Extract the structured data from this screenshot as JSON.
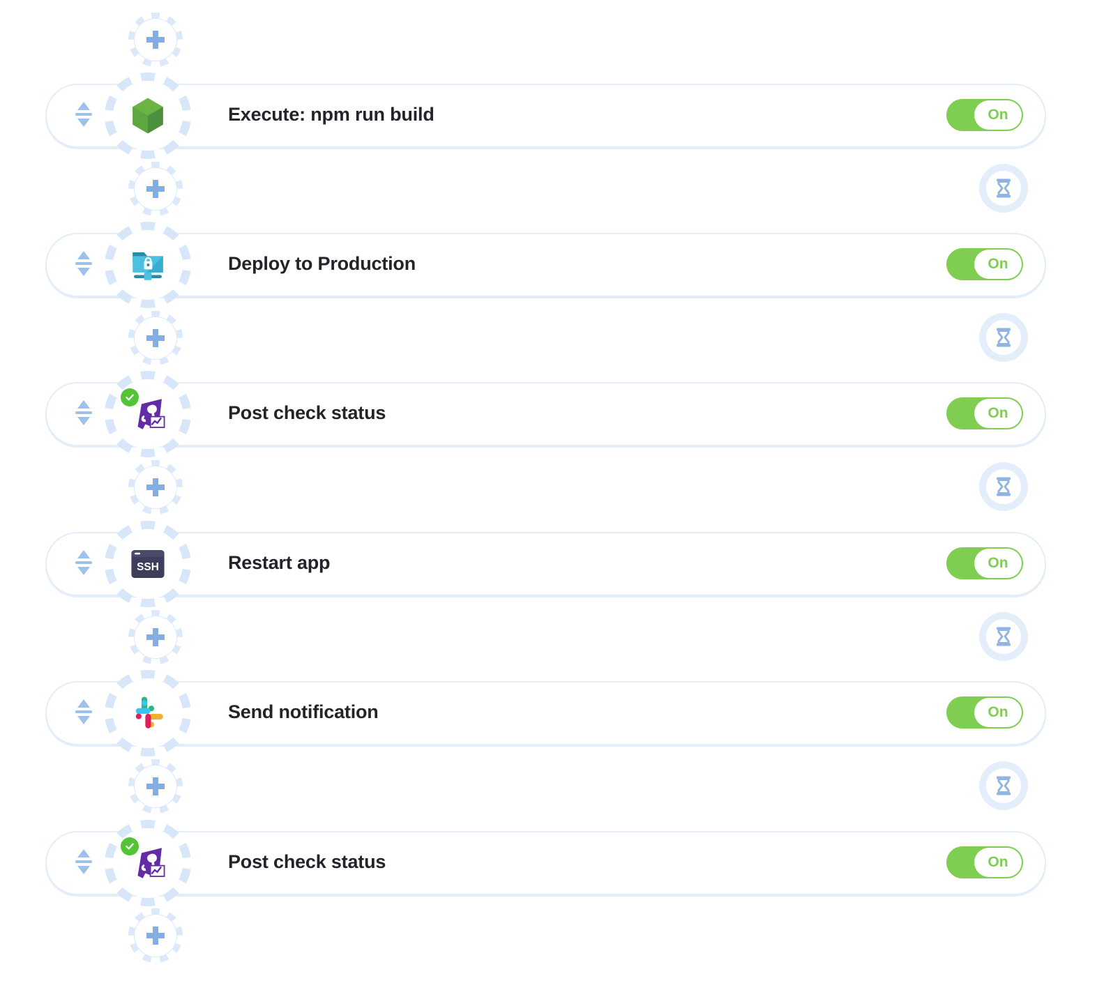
{
  "theme": {
    "accent_green": "#7fce52",
    "gear_blue": "#d7e6f8",
    "border_blue": "#e3edfa",
    "icon_blue": "#8fb5e0",
    "text_dark": "#23242a"
  },
  "toggle": {
    "on_label": "On",
    "state": "on"
  },
  "connectors": {
    "add_label": "add-step",
    "wait_label": "wait-timer"
  },
  "steps": [
    {
      "id": "step-1",
      "label": "Execute: npm run build",
      "icon": "nodejs-icon",
      "badge": null,
      "toggle": "On",
      "handle": "reorder-handle"
    },
    {
      "id": "step-2",
      "label": "Deploy to Production",
      "icon": "sftp-folder-lock-icon",
      "badge": null,
      "toggle": "On",
      "handle": "reorder-handle"
    },
    {
      "id": "step-3",
      "label": "Post check status",
      "icon": "datadog-icon",
      "badge": "check-badge",
      "toggle": "On",
      "handle": "reorder-handle"
    },
    {
      "id": "step-4",
      "label": "Restart app",
      "icon": "ssh-terminal-icon",
      "badge": null,
      "toggle": "On",
      "handle": "reorder-handle"
    },
    {
      "id": "step-5",
      "label": "Send notification",
      "icon": "slack-icon",
      "badge": null,
      "toggle": "On",
      "handle": "reorder-handle"
    },
    {
      "id": "step-6",
      "label": "Post check status",
      "icon": "datadog-icon",
      "badge": "check-badge",
      "toggle": "On",
      "handle": "reorder-handle"
    }
  ],
  "layout": {
    "row_tops": [
      120,
      334,
      548,
      763,
      977,
      1192
    ],
    "connector_tops": [
      18,
      232,
      446,
      660,
      875,
      1089,
      1303
    ],
    "wait_on_connectors": [
      false,
      true,
      true,
      true,
      true,
      true,
      false
    ]
  }
}
